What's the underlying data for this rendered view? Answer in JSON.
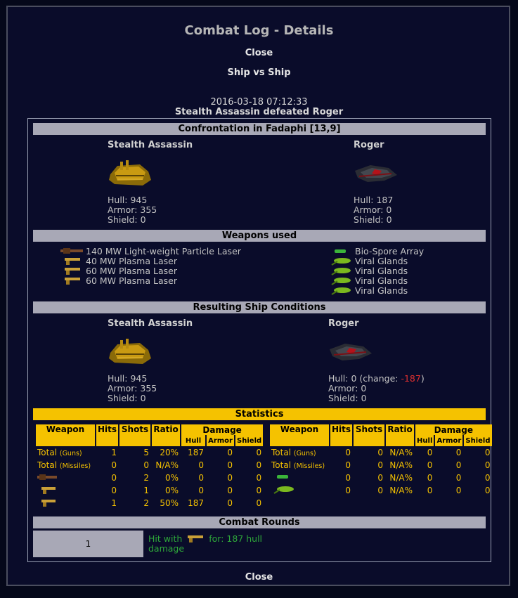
{
  "page": {
    "title": "Combat Log - Details",
    "close_top": "Close",
    "close_bottom": "Close",
    "subtitle": "Ship vs Ship",
    "timestamp": "2016-03-18 07:12:33",
    "result": "Stealth Assassin defeated Roger"
  },
  "confrontation": {
    "header": "Confrontation in Fadaphi [13,9]",
    "attacker": {
      "name": "Stealth Assassin",
      "hull": "Hull: 945",
      "armor": "Armor: 355",
      "shield": "Shield: 0"
    },
    "defender": {
      "name": "Roger",
      "hull": "Hull: 187",
      "armor": "Armor: 0",
      "shield": "Shield: 0"
    }
  },
  "weapons": {
    "header": "Weapons used",
    "attacker": [
      {
        "label": "140 MW Light-weight Particle Laser",
        "icon": "particle-laser-icon"
      },
      {
        "label": "40 MW Plasma Laser",
        "icon": "plasma-laser-icon"
      },
      {
        "label": "60 MW Plasma Laser",
        "icon": "plasma-laser-icon"
      },
      {
        "label": "60 MW Plasma Laser",
        "icon": "plasma-laser-icon"
      }
    ],
    "defender": [
      {
        "label": "Bio-Spore Array",
        "icon": "bio-spore-icon"
      },
      {
        "label": "Viral Glands",
        "icon": "viral-gland-icon"
      },
      {
        "label": "Viral Glands",
        "icon": "viral-gland-icon"
      },
      {
        "label": "Viral Glands",
        "icon": "viral-gland-icon"
      },
      {
        "label": "Viral Glands",
        "icon": "viral-gland-icon"
      }
    ]
  },
  "conditions": {
    "header": "Resulting Ship Conditions",
    "attacker": {
      "name": "Stealth Assassin",
      "hull": "Hull: 945",
      "armor": "Armor: 355",
      "shield": "Shield: 0"
    },
    "defender": {
      "name": "Roger",
      "hull_prefix": "Hull: 0 (change: ",
      "hull_change": "-187",
      "hull_suffix": ")",
      "armor": "Armor: 0",
      "shield": "Shield: 0"
    }
  },
  "statistics": {
    "header": "Statistics",
    "columns": {
      "weapon": "Weapon",
      "hits": "Hits",
      "shots": "Shots",
      "ratio": "Ratio",
      "damage": "Damage",
      "hull": "Hull",
      "armor": "Armor",
      "shield": "Shield"
    },
    "total_label": "Total",
    "guns_label": "(Guns)",
    "missiles_label": "(Missiles)",
    "left": {
      "guns": {
        "hits": "1",
        "shots": "5",
        "ratio": "20%",
        "hull": "187",
        "armor": "0",
        "shield": "0"
      },
      "missiles": {
        "hits": "0",
        "shots": "0",
        "ratio": "N/A%",
        "hull": "0",
        "armor": "0",
        "shield": "0"
      },
      "rows": [
        {
          "icon": "particle-laser-icon",
          "hits": "0",
          "shots": "2",
          "ratio": "0%",
          "hull": "0",
          "armor": "0",
          "shield": "0"
        },
        {
          "icon": "plasma-laser-icon",
          "hits": "0",
          "shots": "1",
          "ratio": "0%",
          "hull": "0",
          "armor": "0",
          "shield": "0"
        },
        {
          "icon": "plasma-laser-icon",
          "hits": "1",
          "shots": "2",
          "ratio": "50%",
          "hull": "187",
          "armor": "0",
          "shield": "0"
        }
      ]
    },
    "right": {
      "guns": {
        "hits": "0",
        "shots": "0",
        "ratio": "N/A%",
        "hull": "0",
        "armor": "0",
        "shield": "0"
      },
      "missiles": {
        "hits": "0",
        "shots": "0",
        "ratio": "N/A%",
        "hull": "0",
        "armor": "0",
        "shield": "0"
      },
      "rows": [
        {
          "icon": "bio-spore-icon",
          "hits": "0",
          "shots": "0",
          "ratio": "N/A%",
          "hull": "0",
          "armor": "0",
          "shield": "0"
        },
        {
          "icon": "viral-gland-icon",
          "hits": "0",
          "shots": "0",
          "ratio": "N/A%",
          "hull": "0",
          "armor": "0",
          "shield": "0"
        }
      ]
    }
  },
  "rounds": {
    "header": "Combat Rounds",
    "round_number": "1",
    "hit_prefix": "Hit with",
    "hit_suffix": "for: 187 hull damage"
  },
  "colors": {
    "accent": "#f5c200",
    "bar": "#a8a8b6",
    "negative": "#e03030",
    "hit": "#2ea83a"
  }
}
